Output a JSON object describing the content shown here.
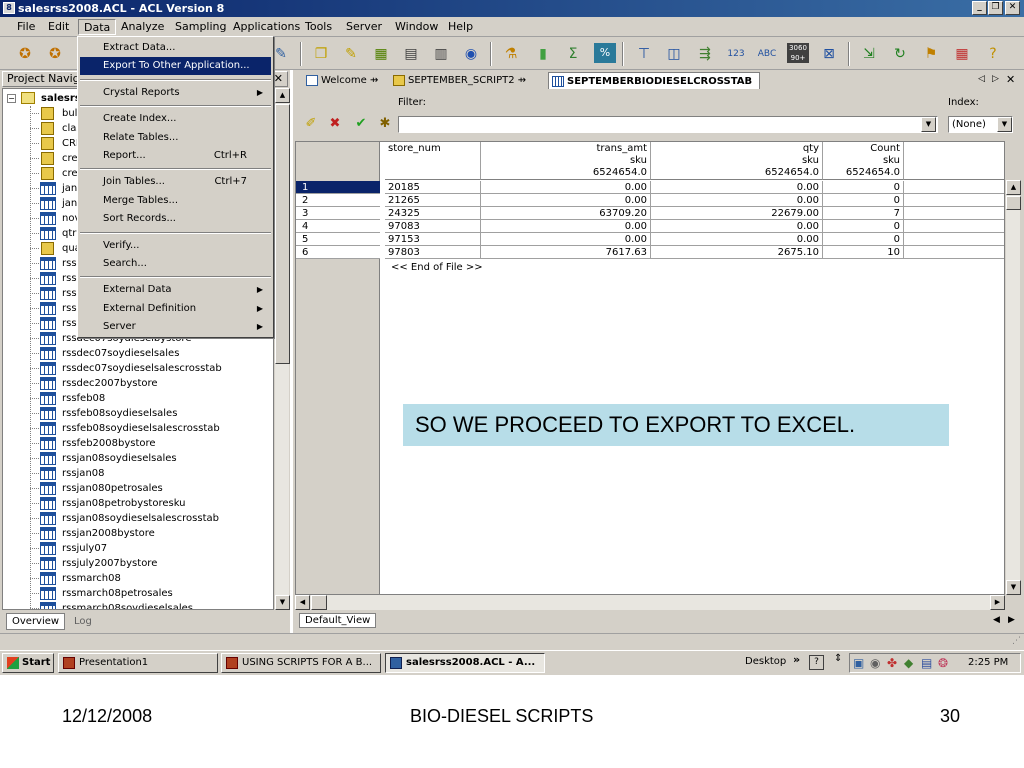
{
  "window": {
    "title": "salesrss2008.ACL - ACL Version 8"
  },
  "menubar": [
    "File",
    "Edit",
    "Data",
    "Analyze",
    "Sampling",
    "Applications",
    "Tools",
    "Server",
    "Window",
    "Help"
  ],
  "data_menu": {
    "groups": [
      [
        {
          "label": "Extract Data..."
        },
        {
          "label": "Export To Other Application...",
          "highlighted": true
        }
      ],
      [
        {
          "label": "Crystal Reports",
          "submenu": true
        }
      ],
      [
        {
          "label": "Create Index..."
        },
        {
          "label": "Relate Tables..."
        },
        {
          "label": "Report...",
          "shortcut": "Ctrl+R"
        }
      ],
      [
        {
          "label": "Join Tables...",
          "shortcut": "Ctrl+7"
        },
        {
          "label": "Merge Tables..."
        },
        {
          "label": "Sort Records..."
        }
      ],
      [
        {
          "label": "Verify..."
        },
        {
          "label": "Search..."
        }
      ],
      [
        {
          "label": "External Data",
          "submenu": true
        },
        {
          "label": "External Definition",
          "submenu": true
        },
        {
          "label": "Server",
          "submenu": true
        }
      ]
    ]
  },
  "project": {
    "header": "Project Navigator",
    "root": "salesrss2008",
    "items": [
      {
        "label": "bull",
        "icon": "script"
      },
      {
        "label": "clas",
        "icon": "script"
      },
      {
        "label": "CRI",
        "icon": "script"
      },
      {
        "label": "cre",
        "icon": "script"
      },
      {
        "label": "cre",
        "icon": "script"
      },
      {
        "label": "jan",
        "icon": "table"
      },
      {
        "label": "jan",
        "icon": "table"
      },
      {
        "label": "nov",
        "icon": "table"
      },
      {
        "label": "qtr",
        "icon": "table"
      },
      {
        "label": "qua",
        "icon": "script"
      },
      {
        "label": "rss",
        "icon": "table"
      },
      {
        "label": "rss",
        "icon": "table"
      },
      {
        "label": "rss",
        "icon": "table"
      },
      {
        "label": "rss",
        "icon": "table"
      },
      {
        "label": "rss",
        "icon": "table"
      },
      {
        "label": "rssdec07soydieselbystore",
        "icon": "table"
      },
      {
        "label": "rssdec07soydieselsales",
        "icon": "table"
      },
      {
        "label": "rssdec07soydieselsalescrosstab",
        "icon": "table"
      },
      {
        "label": "rssdec2007bystore",
        "icon": "table"
      },
      {
        "label": "rssfeb08",
        "icon": "table"
      },
      {
        "label": "rssfeb08soydieselsales",
        "icon": "table"
      },
      {
        "label": "rssfeb08soydieselsalescrosstab",
        "icon": "table"
      },
      {
        "label": "rssfeb2008bystore",
        "icon": "table"
      },
      {
        "label": "rssjan08soydieselsales",
        "icon": "table"
      },
      {
        "label": "rssjan08",
        "icon": "table"
      },
      {
        "label": "rssjan080petrosales",
        "icon": "table"
      },
      {
        "label": "rssjan08petrobystoresku",
        "icon": "table"
      },
      {
        "label": "rssjan08soydieselsalescrosstab",
        "icon": "table"
      },
      {
        "label": "rssjan2008bystore",
        "icon": "table"
      },
      {
        "label": "rssjuly07",
        "icon": "table"
      },
      {
        "label": "rssjuly2007bystore",
        "icon": "table"
      },
      {
        "label": "rssmarch08",
        "icon": "table"
      },
      {
        "label": "rssmarch08petrosales",
        "icon": "table"
      },
      {
        "label": "rssmarch08soydieselsales",
        "icon": "table"
      }
    ],
    "tabs": [
      "Overview",
      "Log"
    ]
  },
  "tabs": [
    {
      "label": "Welcome"
    },
    {
      "label": "SEPTEMBER_SCRIPT2"
    },
    {
      "label": "SEPTEMBERBIODIESELCROSSTAB",
      "active": true
    }
  ],
  "filter": {
    "label": "Filter:",
    "value": ""
  },
  "index": {
    "label": "Index:",
    "value": "(None)"
  },
  "grid": {
    "columns": [
      {
        "lines": [
          "store_num",
          "",
          ""
        ],
        "align": "left"
      },
      {
        "lines": [
          "trans_amt",
          "sku",
          "6524654.0"
        ],
        "align": "right"
      },
      {
        "lines": [
          "qty",
          "sku",
          "6524654.0"
        ],
        "align": "right"
      },
      {
        "lines": [
          "Count",
          "sku",
          "6524654.0"
        ],
        "align": "right"
      }
    ],
    "rows": [
      {
        "n": "1",
        "cells": [
          "20185",
          "0.00",
          "0.00",
          "0"
        ],
        "selected": true
      },
      {
        "n": "2",
        "cells": [
          "21265",
          "0.00",
          "0.00",
          "0"
        ]
      },
      {
        "n": "3",
        "cells": [
          "24325",
          "63709.20",
          "22679.00",
          "7"
        ]
      },
      {
        "n": "4",
        "cells": [
          "97083",
          "0.00",
          "0.00",
          "0"
        ]
      },
      {
        "n": "5",
        "cells": [
          "97153",
          "0.00",
          "0.00",
          "0"
        ]
      },
      {
        "n": "6",
        "cells": [
          "97803",
          "7617.63",
          "2675.10",
          "10"
        ]
      }
    ],
    "eof": "<< End of File >>"
  },
  "callout": "SO WE PROCEED TO EXPORT TO EXCEL.",
  "view_tab": "Default_View",
  "taskbar": {
    "start": "Start",
    "buttons": [
      {
        "label": "Presentation1"
      },
      {
        "label": "USING SCRIPTS FOR A B..."
      },
      {
        "label": "salesrss2008.ACL - A...",
        "active": true
      }
    ],
    "desktop": "Desktop",
    "time": "2:25 PM"
  },
  "footer": {
    "date": "12/12/2008",
    "title": "BIO-DIESEL SCRIPTS",
    "page": "30"
  }
}
